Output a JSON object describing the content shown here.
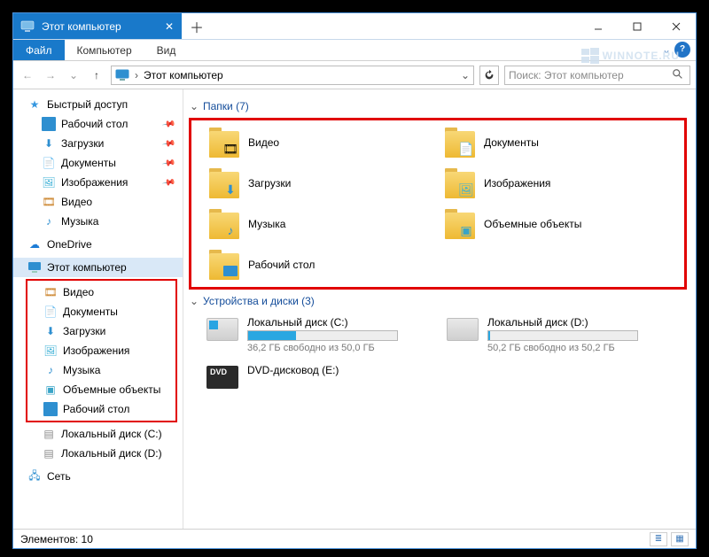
{
  "window": {
    "tab_title": "Этот компьютер"
  },
  "menu": {
    "file": "Файл",
    "computer": "Компьютер",
    "view": "Вид"
  },
  "address": {
    "location": "Этот компьютер"
  },
  "search": {
    "placeholder": "Поиск: Этот компьютер"
  },
  "sidebar": {
    "quick_access": "Быстрый доступ",
    "qa_items": [
      {
        "label": "Рабочий стол",
        "icon": "desktop"
      },
      {
        "label": "Загрузки",
        "icon": "downloads"
      },
      {
        "label": "Документы",
        "icon": "documents"
      },
      {
        "label": "Изображения",
        "icon": "pictures"
      },
      {
        "label": "Видео",
        "icon": "videos"
      },
      {
        "label": "Музыка",
        "icon": "music"
      }
    ],
    "onedrive": "OneDrive",
    "this_pc": "Этот компьютер",
    "pc_items": [
      {
        "label": "Видео",
        "icon": "videos"
      },
      {
        "label": "Документы",
        "icon": "documents"
      },
      {
        "label": "Загрузки",
        "icon": "downloads"
      },
      {
        "label": "Изображения",
        "icon": "pictures"
      },
      {
        "label": "Музыка",
        "icon": "music"
      },
      {
        "label": "Объемные объекты",
        "icon": "3dobjects"
      },
      {
        "label": "Рабочий стол",
        "icon": "desktop"
      }
    ],
    "drives": [
      {
        "label": "Локальный диск (C:)"
      },
      {
        "label": "Локальный диск (D:)"
      }
    ],
    "network": "Сеть"
  },
  "content": {
    "folders_header": "Папки (7)",
    "folders": [
      {
        "label": "Видео"
      },
      {
        "label": "Документы"
      },
      {
        "label": "Загрузки"
      },
      {
        "label": "Изображения"
      },
      {
        "label": "Музыка"
      },
      {
        "label": "Объемные объекты"
      },
      {
        "label": "Рабочий стол"
      }
    ],
    "drives_header": "Устройства и диски (3)",
    "drives": [
      {
        "label": "Локальный диск (C:)",
        "free_text": "36,2 ГБ свободно из 50,0 ГБ",
        "used_pct": 32
      },
      {
        "label": "Локальный диск (D:)",
        "free_text": "50,2 ГБ свободно из 50,2 ГБ",
        "used_pct": 1
      },
      {
        "label": "DVD-дисковод (E:)",
        "is_dvd": true
      }
    ]
  },
  "status": {
    "elements": "Элементов: 10"
  },
  "watermark": "WINNOTE.RU"
}
